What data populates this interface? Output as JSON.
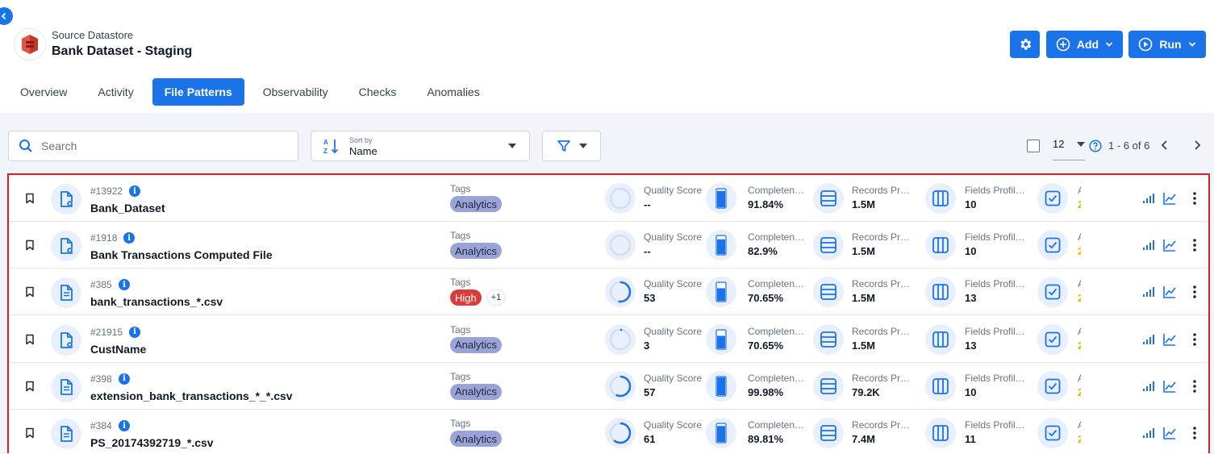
{
  "header": {
    "subtitle": "Source Datastore",
    "title": "Bank Dataset - Staging",
    "add_label": "Add",
    "run_label": "Run"
  },
  "tabs": [
    {
      "label": "Overview",
      "active": false
    },
    {
      "label": "Activity",
      "active": false
    },
    {
      "label": "File Patterns",
      "active": true
    },
    {
      "label": "Observability",
      "active": false
    },
    {
      "label": "Checks",
      "active": false
    },
    {
      "label": "Anomalies",
      "active": false
    }
  ],
  "toolbar": {
    "search_placeholder": "Search",
    "sort_label": "Sort by",
    "sort_value": "Name",
    "page_size": "12",
    "page_range": "1 - 6 of 6"
  },
  "labels": {
    "tags": "Tags",
    "quality_score": "Quality Score",
    "completeness": "Completeness",
    "records_profiled": "Records Profiled",
    "fields_profiled": "Fields Profiled"
  },
  "colors": {
    "accent": "#1a73e8",
    "tag_analytics": "#9aa3d8",
    "tag_high": "#dc3b3b",
    "highlight_border": "#e11d1d"
  },
  "rows": [
    {
      "id": "#13922",
      "name": "Bank_Dataset",
      "icon": "file-settings-icon",
      "tag": "Analytics",
      "tag_kind": "analytics",
      "more": "",
      "quality": "--",
      "quality_pct": 0,
      "completeness": "91.84%",
      "completeness_pct": 91.84,
      "records": "1.5M",
      "fields": "10"
    },
    {
      "id": "#1918",
      "name": "Bank Transactions Computed File",
      "icon": "file-settings-icon",
      "tag": "Analytics",
      "tag_kind": "analytics",
      "more": "",
      "quality": "--",
      "quality_pct": 0,
      "completeness": "82.9%",
      "completeness_pct": 82.9,
      "records": "1.5M",
      "fields": "10"
    },
    {
      "id": "#385",
      "name": "bank_transactions_*.csv",
      "icon": "file-text-icon",
      "tag": "High",
      "tag_kind": "high",
      "more": "+1",
      "quality": "53",
      "quality_pct": 53,
      "completeness": "70.65%",
      "completeness_pct": 70.65,
      "records": "1.5M",
      "fields": "13"
    },
    {
      "id": "#21915",
      "name": "CustName",
      "icon": "file-settings-icon",
      "tag": "Analytics",
      "tag_kind": "analytics",
      "more": "",
      "quality": "3",
      "quality_pct": 3,
      "completeness": "70.65%",
      "completeness_pct": 70.65,
      "records": "1.5M",
      "fields": "13"
    },
    {
      "id": "#398",
      "name": "extension_bank_transactions_*_*.csv",
      "icon": "file-text-icon",
      "tag": "Analytics",
      "tag_kind": "analytics",
      "more": "",
      "quality": "57",
      "quality_pct": 57,
      "completeness": "99.98%",
      "completeness_pct": 99.98,
      "records": "79.2K",
      "fields": "10"
    },
    {
      "id": "#384",
      "name": "PS_20174392719_*.csv",
      "icon": "file-text-icon",
      "tag": "Analytics",
      "tag_kind": "analytics",
      "more": "",
      "quality": "61",
      "quality_pct": 61,
      "completeness": "89.81%",
      "completeness_pct": 89.81,
      "records": "7.4M",
      "fields": "11"
    }
  ]
}
